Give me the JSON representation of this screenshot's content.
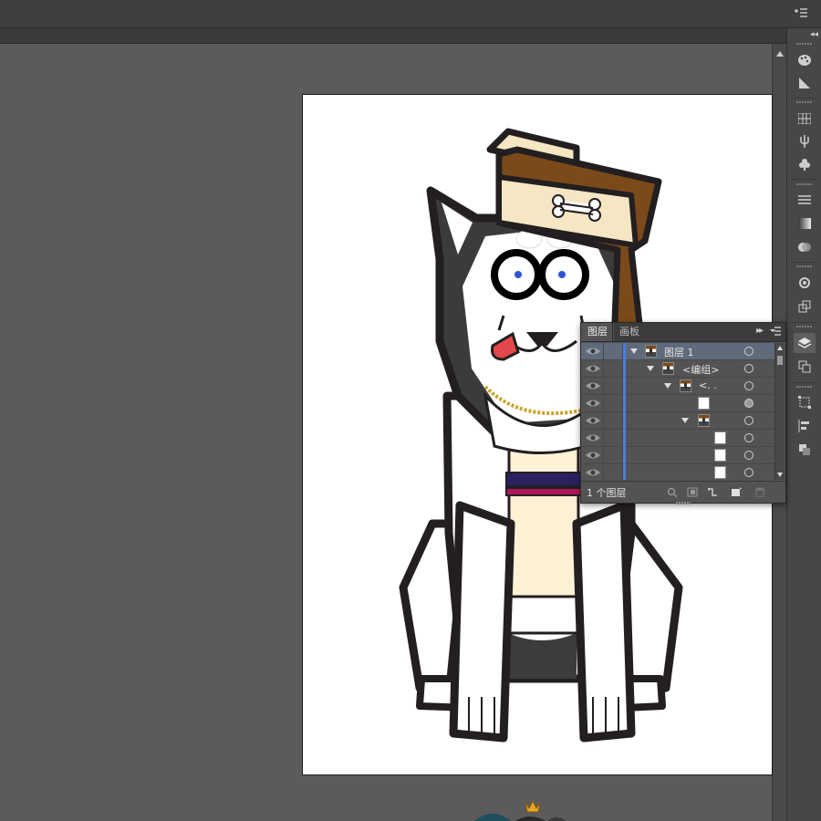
{
  "layers_panel": {
    "tabs": [
      "图层",
      "画板"
    ],
    "rows": [
      {
        "name": "图层 1"
      },
      {
        "name": "<编组>"
      },
      {
        "name": "<. ."
      },
      {
        "name": ""
      },
      {
        "name": ""
      },
      {
        "name": ""
      },
      {
        "name": ""
      },
      {
        "name": ""
      }
    ],
    "footer_count": "1 个图层"
  },
  "colors": {
    "workspace": "#535353",
    "artboard": "#ffffff",
    "layer_color": "#4a7ee3",
    "hat_brown": "#7b4a1a",
    "hat_cream": "#f5e6c4",
    "collar_navy": "#2a2160",
    "collar_magenta": "#b0155d",
    "eye_blue": "#2b56d6",
    "tongue": "#e2474b",
    "chain_gold": "#c9a227"
  },
  "icons": {
    "dock": [
      "palette-icon",
      "gradient-icon",
      "swatches-icon",
      "brushes-icon",
      "symbols-icon",
      "stroke-icon",
      "gradient-panel-icon",
      "transparency-icon",
      "appearance-icon",
      "graphic-styles-icon",
      "layers-icon",
      "artboards-icon",
      "transform-icon",
      "align-icon",
      "pathfinder-icon"
    ]
  }
}
